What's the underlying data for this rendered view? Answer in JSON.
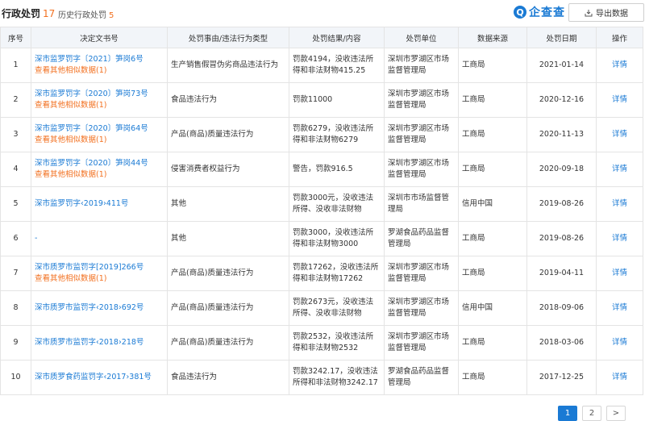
{
  "header": {
    "title": "行政处罚",
    "title_count": "17",
    "history_label": "历史行政处罚",
    "history_count": "5",
    "logo_glyph": "Q",
    "logo_text": "企查查",
    "export_label": "导出数据"
  },
  "table": {
    "columns": [
      "序号",
      "决定文书号",
      "处罚事由/违法行为类型",
      "处罚结果/内容",
      "处罚单位",
      "数据来源",
      "处罚日期",
      "操作"
    ],
    "rows": [
      {
        "no": "1",
        "doc": "深市监罗罚字〔2021〕笋岗6号",
        "similar": "查看其他相似数据(1)",
        "reason": "生产销售假冒伪劣商品违法行为",
        "result": "罚款4194，没收违法所得和非法财物415.25",
        "unit": "深圳市罗湖区市场监督管理局",
        "source": "工商局",
        "date": "2021-01-14",
        "action": "详情"
      },
      {
        "no": "2",
        "doc": "深市监罗罚字〔2020〕笋岗73号",
        "similar": "查看其他相似数据(1)",
        "reason": "食品违法行为",
        "result": "罚款11000",
        "unit": "深圳市罗湖区市场监督管理局",
        "source": "工商局",
        "date": "2020-12-16",
        "action": "详情"
      },
      {
        "no": "3",
        "doc": "深市监罗罚字〔2020〕笋岗64号",
        "similar": "查看其他相似数据(1)",
        "reason": "产品(商品)质量违法行为",
        "result": "罚款6279，没收违法所得和非法财物6279",
        "unit": "深圳市罗湖区市场监督管理局",
        "source": "工商局",
        "date": "2020-11-13",
        "action": "详情"
      },
      {
        "no": "4",
        "doc": "深市监罗罚字〔2020〕笋岗44号",
        "similar": "查看其他相似数据(1)",
        "reason": "侵害消费者权益行为",
        "result": "警告，罚款916.5",
        "unit": "深圳市罗湖区市场监督管理局",
        "source": "工商局",
        "date": "2020-09-18",
        "action": "详情"
      },
      {
        "no": "5",
        "doc": "深市监罗罚字‹2019›411号",
        "similar": "",
        "reason": "其他",
        "result": "罚款3000元，没收违法所得、没收非法财物",
        "unit": "深圳市市场监督管理局",
        "source": "信用中国",
        "date": "2019-08-26",
        "action": "详情"
      },
      {
        "no": "6",
        "doc": "-",
        "similar": "",
        "reason": "其他",
        "result": "罚款3000，没收违法所得和非法财物3000",
        "unit": "罗湖食品药品监督管理局",
        "source": "工商局",
        "date": "2019-08-26",
        "action": "详情"
      },
      {
        "no": "7",
        "doc": "深市质罗市监罚字[2019]266号",
        "similar": "查看其他相似数据(1)",
        "reason": "产品(商品)质量违法行为",
        "result": "罚款17262，没收违法所得和非法财物17262",
        "unit": "深圳市罗湖区市场监督管理局",
        "source": "工商局",
        "date": "2019-04-11",
        "action": "详情"
      },
      {
        "no": "8",
        "doc": "深市质罗市监罚字‹2018›692号",
        "similar": "",
        "reason": "产品(商品)质量违法行为",
        "result": "罚款2673元，没收违法所得、没收非法财物",
        "unit": "深圳市罗湖区市场监督管理局",
        "source": "信用中国",
        "date": "2018-09-06",
        "action": "详情"
      },
      {
        "no": "9",
        "doc": "深市质罗市监罚字‹2018›218号",
        "similar": "",
        "reason": "产品(商品)质量违法行为",
        "result": "罚款2532，没收违法所得和非法财物2532",
        "unit": "深圳市罗湖区市场监督管理局",
        "source": "工商局",
        "date": "2018-03-06",
        "action": "详情"
      },
      {
        "no": "10",
        "doc": "深市质罗食药监罚字‹2017›381号",
        "similar": "",
        "reason": "食品违法行为",
        "result": "罚款3242.17，没收违法所得和非法财物3242.17",
        "unit": "罗湖食品药品监督管理局",
        "source": "工商局",
        "date": "2017-12-25",
        "action": "详情"
      }
    ]
  },
  "pagination": {
    "pages": [
      "1",
      "2"
    ],
    "next": ">"
  },
  "colors": {
    "accent": "#1a7ad4",
    "highlight": "#f27020",
    "header_bg": "#f2f5f9"
  }
}
